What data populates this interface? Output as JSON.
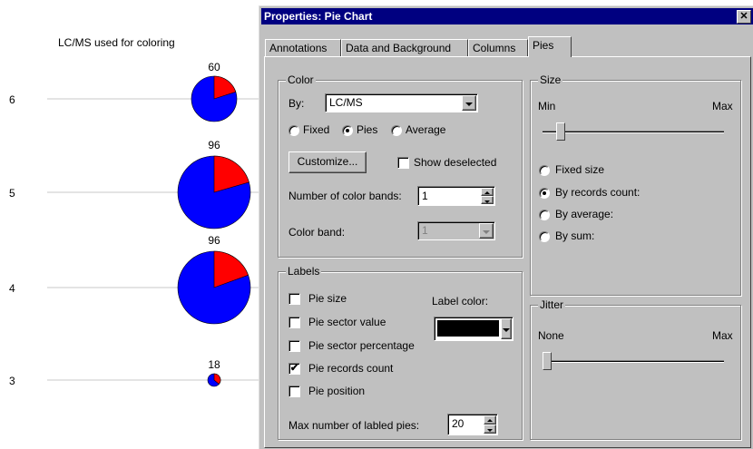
{
  "chart": {
    "caption": "LC/MS used for coloring",
    "y_labels": [
      "6",
      "5",
      "4",
      "3"
    ],
    "colors": {
      "major": "#0000ff",
      "minor": "#ff0000"
    },
    "pies": [
      {
        "y_label": "6",
        "count_label": "60"
      },
      {
        "y_label": "5",
        "count_label": "96"
      },
      {
        "y_label": "4",
        "count_label": "96"
      },
      {
        "y_label": "3",
        "count_label": "18"
      }
    ]
  },
  "dialog": {
    "title": "Properties: Pie Chart",
    "close_glyph": "✕",
    "tabs": [
      "Annotations",
      "Data and Background",
      "Columns",
      "Pies"
    ],
    "active_tab": "Pies",
    "color_group": {
      "label": "Color",
      "by_label": "By:",
      "by_value": "LC/MS",
      "radio_fixed": "Fixed",
      "radio_pies": "Pies",
      "radio_average": "Average",
      "selected": "Pies",
      "customize_button": "Customize...",
      "show_deselected_label": "Show deselected",
      "num_bands_label": "Number of color bands:",
      "num_bands_value": "1",
      "color_band_label": "Color band:",
      "color_band_value": "1"
    },
    "labels_group": {
      "label": "Labels",
      "pie_size": "Pie size",
      "pie_sector_value": "Pie sector value",
      "pie_sector_percentage": "Pie sector percentage",
      "pie_records_count": "Pie records count",
      "pie_position": "Pie position",
      "label_color_label": "Label color:",
      "label_color_value": "#000000",
      "max_labeled_label": "Max number of labled pies:",
      "max_labeled_value": "20"
    },
    "size_group": {
      "label": "Size",
      "min_label": "Min",
      "max_label": "Max",
      "slider_value": 0.08,
      "radio_fixed_size": "Fixed size",
      "radio_by_records_count": "By records count:",
      "radio_by_average": "By average:",
      "radio_by_sum": "By sum:",
      "selected": "By records count:"
    },
    "jitter_group": {
      "label": "Jitter",
      "none_label": "None",
      "max_label": "Max",
      "slider_value": 0.0
    }
  }
}
